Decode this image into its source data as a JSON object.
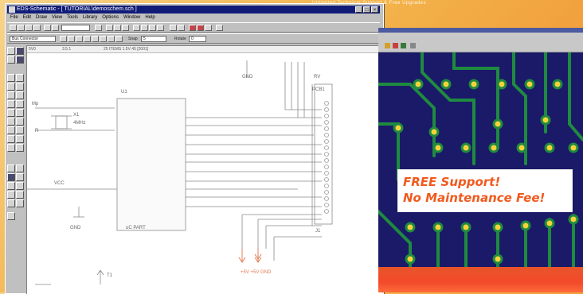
{
  "background": {
    "tagline": "Unlimited Technical Support & Free Upgrades"
  },
  "app": {
    "title": "EDS-Schematic - [ TUTORIAL\\demoschem.sch ]",
    "menu": [
      "File",
      "Edit",
      "Draw",
      "View",
      "Tools",
      "Library",
      "Options",
      "Window",
      "Help"
    ],
    "toolbar2": {
      "layer_value": "Bus Connector",
      "snap_label": "Snap",
      "snap_value": "5",
      "rotate_label": "Rotate",
      "rotate_value": "0"
    },
    "canvas_header": [
      "5V0",
      "3.5.1",
      "25 ITEMS 1.5V 45 [2001]"
    ],
    "schematic_labels": {
      "gnd_top": "GND",
      "rv": "RV",
      "pcb_label": "PCB1",
      "xtal_left": "Mp",
      "xtal_name": "X1",
      "xtal_value": "4MHz",
      "r1": "R",
      "ic": "U1",
      "vcc": "VCC",
      "gnd_bottom": "GND",
      "ic_part": "uC PART",
      "j1": "J1",
      "supply": "+5V   +5V GND",
      "ref_designator": "T1"
    }
  },
  "promo": {
    "line1": "FREE Support!",
    "line2": "No Maintenance Fee!"
  },
  "colors": {
    "promo_text": "#f05a1e",
    "pcb_board": "#1a1a68",
    "pcb_trace": "#1f8a40",
    "pad": "#f6d23a"
  }
}
